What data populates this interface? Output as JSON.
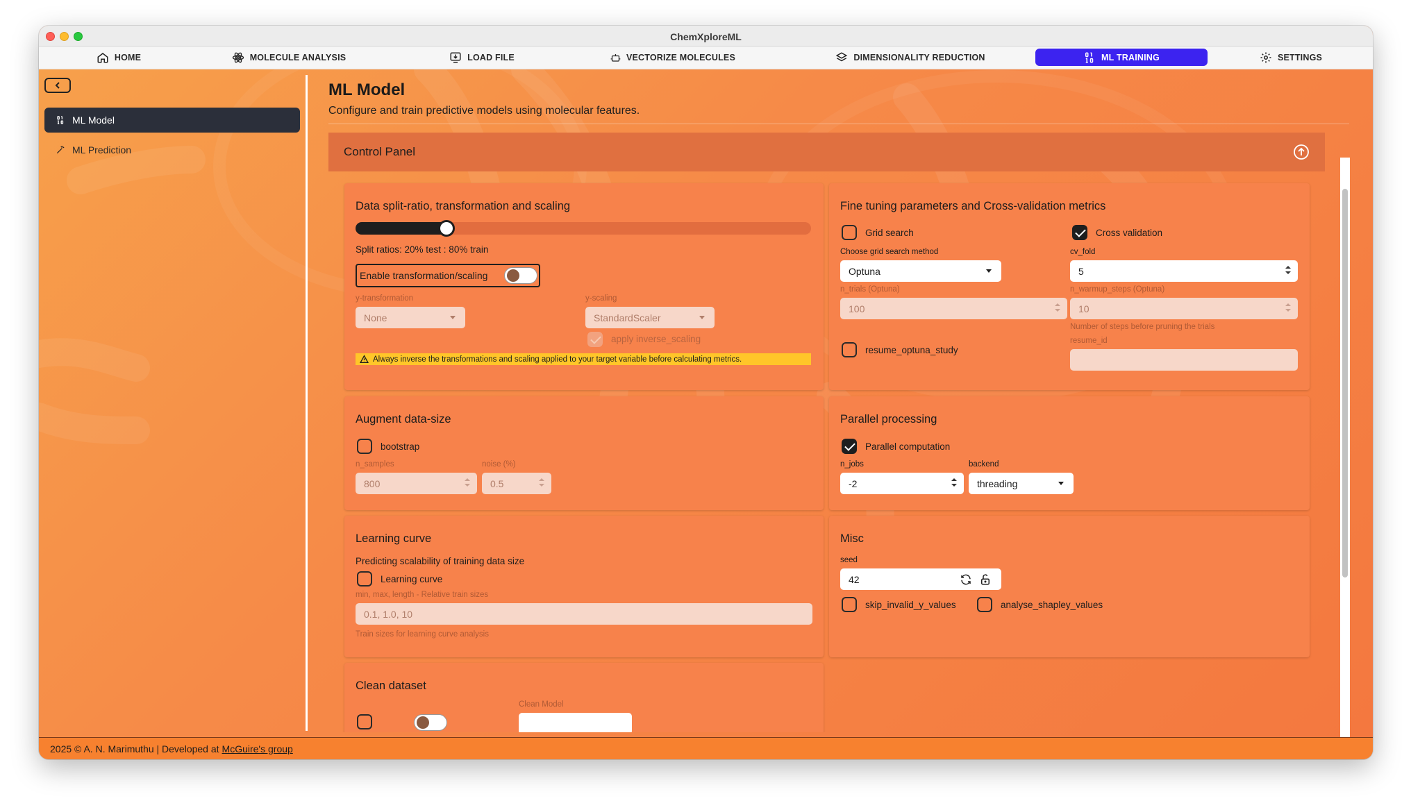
{
  "window": {
    "title": "ChemXploreML"
  },
  "nav": {
    "items": [
      {
        "label": "HOME",
        "icon": "home-icon"
      },
      {
        "label": "MOLECULE ANALYSIS",
        "icon": "atom-icon"
      },
      {
        "label": "LOAD FILE",
        "icon": "load-file-icon"
      },
      {
        "label": "VECTORIZE MOLECULES",
        "icon": "robot-icon"
      },
      {
        "label": "DIMENSIONALITY REDUCTION",
        "icon": "layers-icon"
      },
      {
        "label": "ML TRAINING",
        "icon": "binary-icon",
        "active": true
      },
      {
        "label": "SETTINGS",
        "icon": "gear-icon"
      }
    ]
  },
  "sidebar": {
    "items": [
      {
        "label": "ML Model",
        "icon": "binary-icon",
        "active": true
      },
      {
        "label": "ML Prediction",
        "icon": "wand-icon"
      }
    ]
  },
  "page": {
    "title": "ML Model",
    "subtitle": "Configure and train predictive models using molecular features."
  },
  "panel": {
    "title": "Control Panel"
  },
  "split": {
    "title": "Data split-ratio, transformation and scaling",
    "ratio_text": "Split ratios: 20% test : 80% train",
    "test_fraction": 0.2,
    "toggle_label": "Enable transformation/scaling",
    "y_transformation_label": "y-transformation",
    "y_transformation_value": "None",
    "y_scaling_label": "y-scaling",
    "y_scaling_value": "StandardScaler",
    "inverse_label": "apply inverse_scaling",
    "warning": "Always inverse the transformations and scaling applied to your target variable before calculating metrics."
  },
  "finetune": {
    "title": "Fine tuning parameters and Cross-validation metrics",
    "grid_search_label": "Grid search",
    "cross_validation_label": "Cross validation",
    "method_label": "Choose grid search method",
    "method_value": "Optuna",
    "cv_fold_label": "cv_fold",
    "cv_fold_value": "5",
    "n_trials_label": "n_trials (Optuna)",
    "n_trials_value": "100",
    "n_warmup_label": "n_warmup_steps (Optuna)",
    "n_warmup_value": "10",
    "warmup_help": "Number of steps before pruning the trials",
    "resume_label": "resume_optuna_study",
    "resume_id_label": "resume_id",
    "resume_id_value": ""
  },
  "augment": {
    "title": "Augment data-size",
    "bootstrap_label": "bootstrap",
    "n_samples_label": "n_samples",
    "n_samples_value": "800",
    "noise_label": "noise (%)",
    "noise_value": "0.5"
  },
  "parallel": {
    "title": "Parallel processing",
    "parallel_label": "Parallel computation",
    "n_jobs_label": "n_jobs",
    "n_jobs_value": "-2",
    "backend_label": "backend",
    "backend_value": "threading"
  },
  "learning": {
    "title": "Learning curve",
    "subtitle": "Predicting scalability of training data size",
    "checkbox_label": "Learning curve",
    "sizes_label": "min, max, length - Relative train sizes",
    "sizes_placeholder": "0.1, 1.0, 10",
    "sizes_help": "Train sizes for learning curve analysis"
  },
  "misc": {
    "title": "Misc",
    "seed_label": "seed",
    "seed_value": "42",
    "skip_label": "skip_invalid_y_values",
    "shapley_label": "analyse_shapley_values"
  },
  "clean": {
    "title": "Clean dataset",
    "clean_model_label": "Clean Model"
  },
  "footer": {
    "text": "2025 © A. N. Marimuthu | Developed at",
    "link": "McGuire's group"
  }
}
